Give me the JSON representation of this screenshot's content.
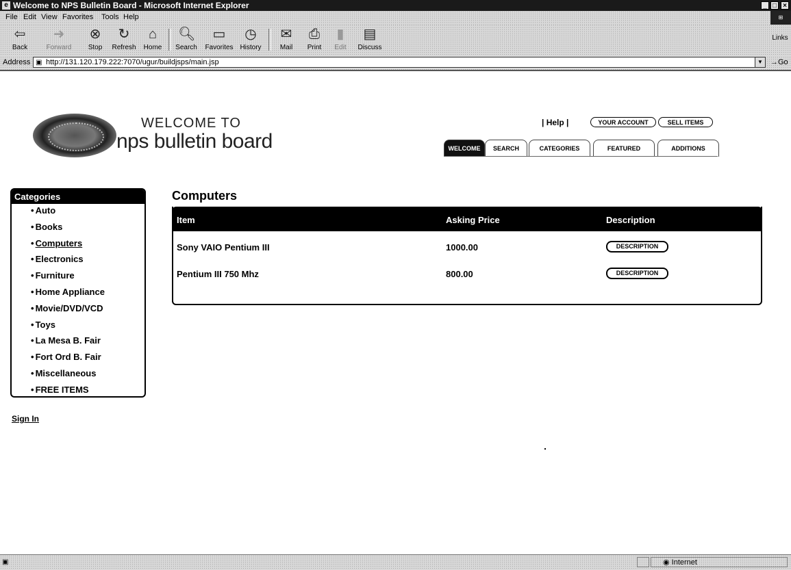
{
  "window": {
    "title": "Welcome to NPS Bulletin Board - Microsoft Internet Explorer"
  },
  "menu": [
    "File",
    "Edit",
    "View",
    "Favorites",
    "Tools",
    "Help"
  ],
  "toolbar": {
    "back": "Back",
    "forward": "Forward",
    "stop": "Stop",
    "refresh": "Refresh",
    "home": "Home",
    "search": "Search",
    "favorites": "Favorites",
    "history": "History",
    "mail": "Mail",
    "print": "Print",
    "edit": "Edit",
    "discuss": "Discuss",
    "links": "Links"
  },
  "address": {
    "label": "Address",
    "url": "http://131.120.179.222:7070/ugur/buildjsps/main.jsp",
    "go": "Go"
  },
  "header": {
    "welcome_to": "WELCOME TO",
    "site_name": "nps bulletin board",
    "help": "| Help |",
    "your_account": "YOUR ACCOUNT",
    "sell_items": "SELL ITEMS"
  },
  "tabs": [
    "WELCOME",
    "SEARCH",
    "CATEGORIES",
    "FEATURED",
    "ADDITIONS"
  ],
  "sidebar": {
    "title": "Categories",
    "items": [
      "Auto",
      "Books",
      "Computers",
      "Electronics",
      "Furniture",
      "Home Appliance",
      "Movie/DVD/VCD",
      "Toys",
      "La Mesa B. Fair",
      "Fort Ord B. Fair",
      "Miscellaneous",
      "FREE ITEMS"
    ],
    "selected": "Computers",
    "sign_in": "Sign In"
  },
  "main": {
    "heading": "Computers",
    "columns": [
      "Item",
      "Asking Price",
      "Description"
    ],
    "rows": [
      {
        "item": "Sony VAIO Pentium III",
        "price": "1000.00",
        "button": "DESCRIPTION"
      },
      {
        "item": "Pentium III 750 Mhz",
        "price": "800.00",
        "button": "DESCRIPTION"
      }
    ]
  },
  "status": {
    "zone": "Internet"
  }
}
